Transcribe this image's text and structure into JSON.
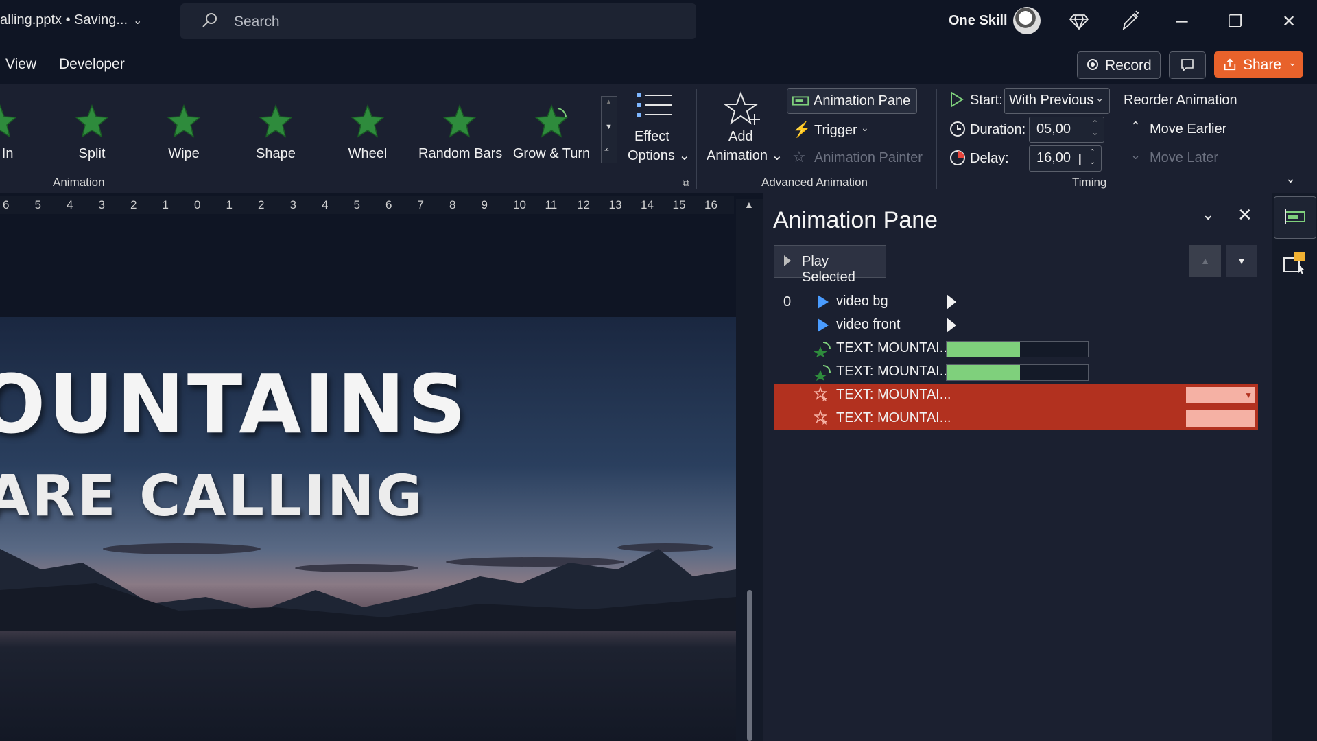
{
  "titlebar": {
    "file_title": "alling.pptx • Saving...",
    "search_placeholder": "Search",
    "user_name": "One Skill",
    "minimize": "─",
    "restore": "❐",
    "close": "✕"
  },
  "tabs": [
    {
      "label": "View"
    },
    {
      "label": "Developer"
    }
  ],
  "actions": {
    "record": "Record",
    "share": "Share"
  },
  "ribbon": {
    "animation_gallery": [
      {
        "label": "at In"
      },
      {
        "label": "Split"
      },
      {
        "label": "Wipe"
      },
      {
        "label": "Shape"
      },
      {
        "label": "Wheel"
      },
      {
        "label": "Random Bars"
      },
      {
        "label": "Grow & Turn"
      }
    ],
    "effect_options_line1": "Effect",
    "effect_options_line2": "Options",
    "animation_group_label": "Animation",
    "add_animation_line1": "Add",
    "add_animation_line2": "Animation",
    "animation_pane_button": "Animation Pane",
    "trigger": "Trigger",
    "animation_painter": "Animation Painter",
    "advanced_group_label": "Advanced Animation",
    "start_label": "Start:",
    "start_value": "With Previous",
    "duration_label": "Duration:",
    "duration_value": "05,00",
    "delay_label": "Delay:",
    "delay_value": "16,00",
    "reorder_title": "Reorder Animation",
    "move_earlier": "Move Earlier",
    "move_later": "Move Later",
    "timing_group_label": "Timing"
  },
  "ruler": {
    "marks": [
      "6",
      "5",
      "4",
      "3",
      "2",
      "1",
      "0",
      "1",
      "2",
      "3",
      "4",
      "5",
      "6",
      "7",
      "8",
      "9",
      "10",
      "11",
      "12",
      "13",
      "14",
      "15",
      "16"
    ]
  },
  "slide": {
    "title": "OUNTAINS",
    "subtitle": "ARE CALLING"
  },
  "animation_pane": {
    "title": "Animation Pane",
    "play_selected": "Play Selected",
    "items": [
      {
        "index": "0",
        "name": "video bg",
        "kind": "media-play",
        "selected": false
      },
      {
        "index": "",
        "name": "video front",
        "kind": "media-play",
        "selected": false
      },
      {
        "index": "",
        "name": "TEXT: MOUNTAI...",
        "kind": "grow-turn",
        "timebar_fill_fraction": 0.52,
        "selected": false
      },
      {
        "index": "",
        "name": "TEXT: MOUNTAI...",
        "kind": "grow-turn",
        "timebar_fill_fraction": 0.52,
        "selected": false
      },
      {
        "index": "",
        "name": "TEXT: MOUNTAI...",
        "kind": "emphasis-star",
        "selected": true
      },
      {
        "index": "",
        "name": "TEXT: MOUNTAI...",
        "kind": "emphasis-star",
        "selected": true
      }
    ]
  },
  "colors": {
    "accent_share": "#e8622b",
    "selection_red": "#b2311f",
    "timebar_green": "#7fd07c",
    "animation_star_green": "#2e8b3c"
  }
}
